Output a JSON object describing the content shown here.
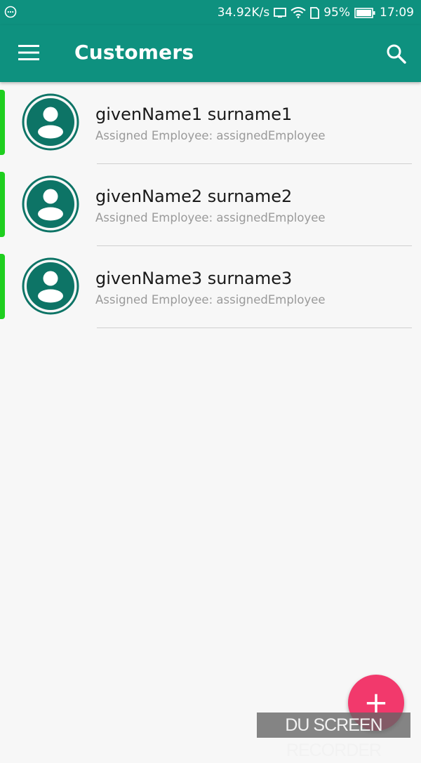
{
  "status_bar": {
    "network_speed": "34.92K/s",
    "battery_percent": "95%",
    "time": "17:09",
    "icons": [
      "notification-dots-icon",
      "screen-cast-icon",
      "wifi-icon",
      "sim-icon",
      "battery-icon"
    ]
  },
  "app_bar": {
    "title": "Customers",
    "menu_icon": "hamburger-menu-icon",
    "search_icon": "search-icon"
  },
  "customers": [
    {
      "name": "givenName1 surname1",
      "subtitle": "Assigned Employee: assignedEmployee"
    },
    {
      "name": "givenName2 surname2",
      "subtitle": "Assigned Employee: assignedEmployee"
    },
    {
      "name": "givenName3 surname3",
      "subtitle": "Assigned Employee: assignedEmployee"
    }
  ],
  "fab": {
    "label": "+",
    "icon": "add-icon"
  },
  "watermark": {
    "text": "DU SCREEN RECORDER"
  },
  "colors": {
    "primary": "#0e917f",
    "avatar": "#0d7466",
    "indicator": "#1fcf1f",
    "fab": "#f2396c"
  }
}
